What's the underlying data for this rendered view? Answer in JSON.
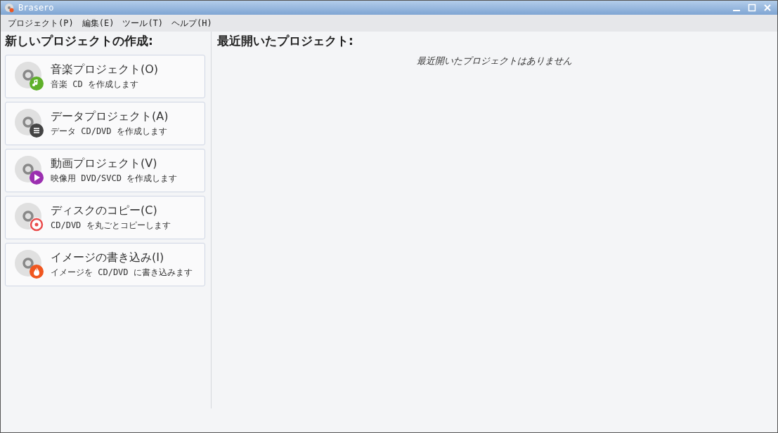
{
  "window": {
    "title": "Brasero"
  },
  "menu": [
    "プロジェクト(P)",
    "編集(E)",
    "ツール(T)",
    "ヘルプ(H)"
  ],
  "new_project": {
    "heading": "新しいプロジェクトの作成:",
    "items": [
      {
        "kind": "music",
        "title": "音楽プロジェクト(O)",
        "description": "音楽 CD を作成します"
      },
      {
        "kind": "data",
        "title": "データプロジェクト(A)",
        "description": "データ CD/DVD を作成します"
      },
      {
        "kind": "video",
        "title": "動画プロジェクト(V)",
        "description": "映像用 DVD/SVCD を作成します"
      },
      {
        "kind": "copy",
        "title": "ディスクのコピー(C)",
        "description": "CD/DVD を丸ごとコピーします"
      },
      {
        "kind": "burn",
        "title": "イメージの書き込み(I)",
        "description": "イメージを CD/DVD に書き込みます"
      }
    ]
  },
  "recent": {
    "heading": "最近開いたプロジェクト:",
    "empty_message": "最近開いたプロジェクトはありません"
  }
}
